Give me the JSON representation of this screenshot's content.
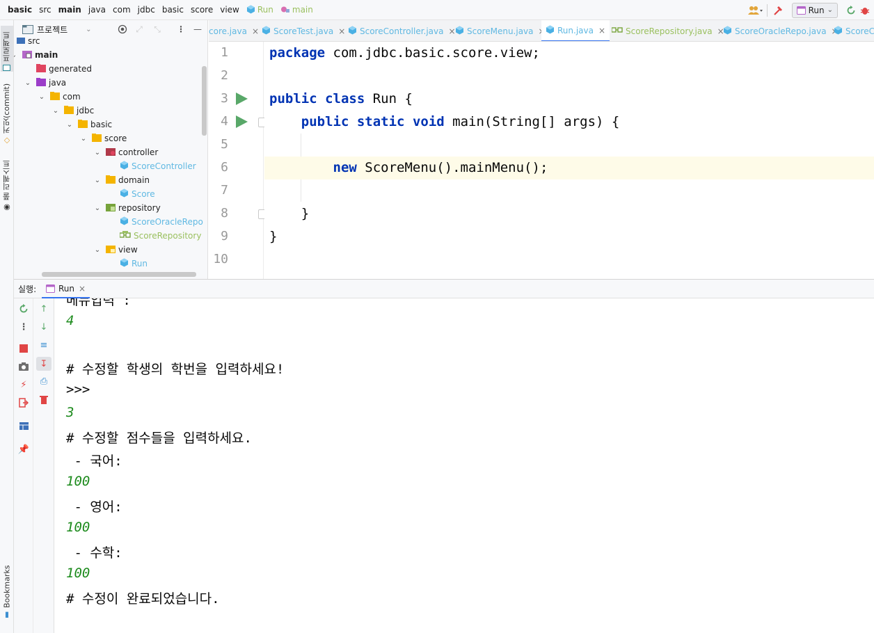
{
  "breadcrumbs": [
    "basic",
    "src",
    "main",
    "java",
    "com",
    "jdbc",
    "basic",
    "score",
    "view",
    "Run",
    "main"
  ],
  "toolbar": {
    "run_config": "Run"
  },
  "left_strip": {
    "project_tab": "프로젝트",
    "commit_tab": "커밋(commit)",
    "pull_requests_tab": "풀 리퀘스트",
    "bookmarks_tab": "Bookmarks"
  },
  "project": {
    "title": "프로젝트",
    "tree": [
      {
        "label": "src",
        "kind": "folder-src"
      },
      {
        "label": "main",
        "kind": "folder-main",
        "bold": true
      },
      {
        "label": "generated",
        "kind": "folder-gen"
      },
      {
        "label": "java",
        "kind": "folder-java"
      },
      {
        "label": "com",
        "kind": "package"
      },
      {
        "label": "jdbc",
        "kind": "package"
      },
      {
        "label": "basic",
        "kind": "package"
      },
      {
        "label": "score",
        "kind": "package"
      },
      {
        "label": "controller",
        "kind": "package-ctrl"
      },
      {
        "label": "ScoreController",
        "kind": "class"
      },
      {
        "label": "domain",
        "kind": "package"
      },
      {
        "label": "Score",
        "kind": "class"
      },
      {
        "label": "repository",
        "kind": "package-repo"
      },
      {
        "label": "ScoreOracleRepo",
        "kind": "class"
      },
      {
        "label": "ScoreRepository",
        "kind": "interface"
      },
      {
        "label": "view",
        "kind": "package-view"
      },
      {
        "label": "Run",
        "kind": "class"
      }
    ]
  },
  "editor": {
    "tabs": [
      {
        "name": "core.java",
        "kind": "class"
      },
      {
        "name": "ScoreTest.java",
        "kind": "class"
      },
      {
        "name": "ScoreController.java",
        "kind": "class"
      },
      {
        "name": "ScoreMenu.java",
        "kind": "class"
      },
      {
        "name": "Run.java",
        "kind": "class",
        "active": true
      },
      {
        "name": "ScoreRepository.java",
        "kind": "interface"
      },
      {
        "name": "ScoreOracleRepo.java",
        "kind": "class"
      },
      {
        "name": "ScoreC",
        "kind": "class"
      }
    ],
    "line_numbers": [
      "1",
      "2",
      "3",
      "4",
      "5",
      "6",
      "7",
      "8",
      "9",
      "10"
    ],
    "code_lines": [
      "package com.jdbc.basic.score.view;",
      "",
      "public class Run {",
      "    public static void main(String[] args) {",
      "",
      "        new ScoreMenu().mainMenu();",
      "",
      "    }",
      "}",
      ""
    ]
  },
  "run_panel": {
    "label": "실행:",
    "tab": "Run",
    "output": [
      {
        "text": "메뉴입력 :",
        "type": "out"
      },
      {
        "text": "4",
        "type": "in"
      },
      {
        "text": "",
        "type": "out"
      },
      {
        "text": "# 수정할 학생의 학번을 입력하세요!",
        "type": "out"
      },
      {
        "text": ">>>",
        "type": "out"
      },
      {
        "text": "3",
        "type": "in"
      },
      {
        "text": "# 수정할 점수들을 입력하세요.",
        "type": "out"
      },
      {
        "text": " - 국어:",
        "type": "out"
      },
      {
        "text": "100",
        "type": "in"
      },
      {
        "text": " - 영어:",
        "type": "out"
      },
      {
        "text": "100",
        "type": "in"
      },
      {
        "text": " - 수학:",
        "type": "out"
      },
      {
        "text": "100",
        "type": "in"
      },
      {
        "text": "# 수정이 완료되었습니다.",
        "type": "out"
      }
    ]
  },
  "colors": {
    "class_name": "#5fb8e2",
    "interface_name": "#9ac05f",
    "keyword": "#0033b3",
    "input_echo": "#1b8a1b",
    "run_green": "#59a869",
    "accent": "#3574f0"
  }
}
